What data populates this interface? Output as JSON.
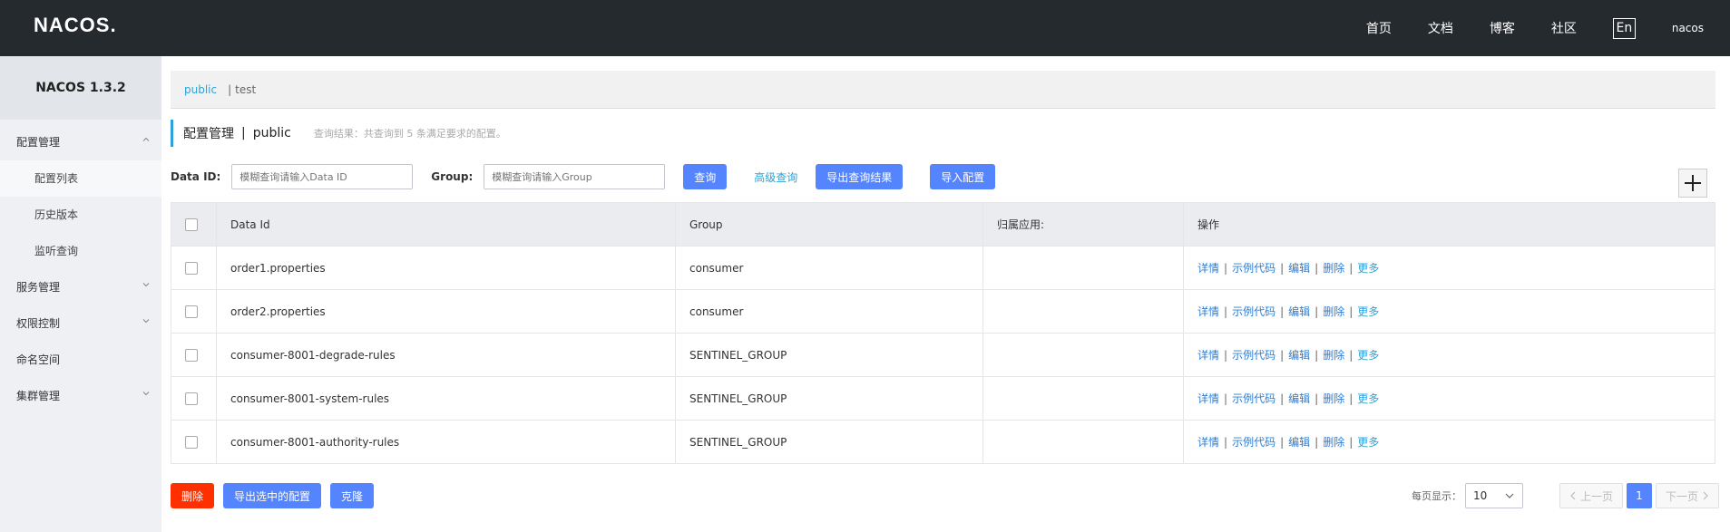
{
  "header": {
    "logo": "NACOS.",
    "nav": [
      "首页",
      "文档",
      "博客",
      "社区"
    ],
    "lang": "En",
    "user": "nacos"
  },
  "sidebar": {
    "version": "NACOS 1.3.2",
    "items": [
      {
        "label": "配置管理",
        "expanded": true
      },
      {
        "label": "配置列表"
      },
      {
        "label": "历史版本"
      },
      {
        "label": "监听查询"
      },
      {
        "label": "服务管理"
      },
      {
        "label": "权限控制"
      },
      {
        "label": "命名空间"
      },
      {
        "label": "集群管理"
      }
    ]
  },
  "namespace": {
    "active": "public",
    "separator": "|",
    "other": "test"
  },
  "title": {
    "main": "配置管理",
    "separator": "|",
    "namespace": "public",
    "summary": "查询结果：共查询到 5 条满足要求的配置。"
  },
  "filter": {
    "dataid_label": "Data ID:",
    "dataid_placeholder": "模糊查询请输入Data ID",
    "group_label": "Group:",
    "group_placeholder": "模糊查询请输入Group",
    "query_btn": "查询",
    "advanced_btn": "高级查询",
    "export_btn": "导出查询结果",
    "import_btn": "导入配置"
  },
  "table": {
    "headers": [
      "Data Id",
      "Group",
      "归属应用:",
      "操作"
    ],
    "rows": [
      {
        "dataid": "order1.properties",
        "group": "consumer",
        "app": ""
      },
      {
        "dataid": "order2.properties",
        "group": "consumer",
        "app": ""
      },
      {
        "dataid": "consumer-8001-degrade-rules",
        "group": "SENTINEL_GROUP",
        "app": ""
      },
      {
        "dataid": "consumer-8001-system-rules",
        "group": "SENTINEL_GROUP",
        "app": ""
      },
      {
        "dataid": "consumer-8001-authority-rules",
        "group": "SENTINEL_GROUP",
        "app": ""
      }
    ],
    "ops": {
      "detail": "详情",
      "sample": "示例代码",
      "edit": "编辑",
      "delete": "删除",
      "more": "更多",
      "sep": "|"
    }
  },
  "bottom": {
    "delete_btn": "删除",
    "export_selected_btn": "导出选中的配置",
    "clone_btn": "克隆"
  },
  "pagination": {
    "label": "每页显示：",
    "page_size": "10",
    "prev": "上一页",
    "current": "1",
    "next": "下一页"
  },
  "colors": {
    "primary": "#5584ff",
    "danger": "#ff3000",
    "link": "#2fa1d6",
    "header_bg": "#252a2f"
  }
}
